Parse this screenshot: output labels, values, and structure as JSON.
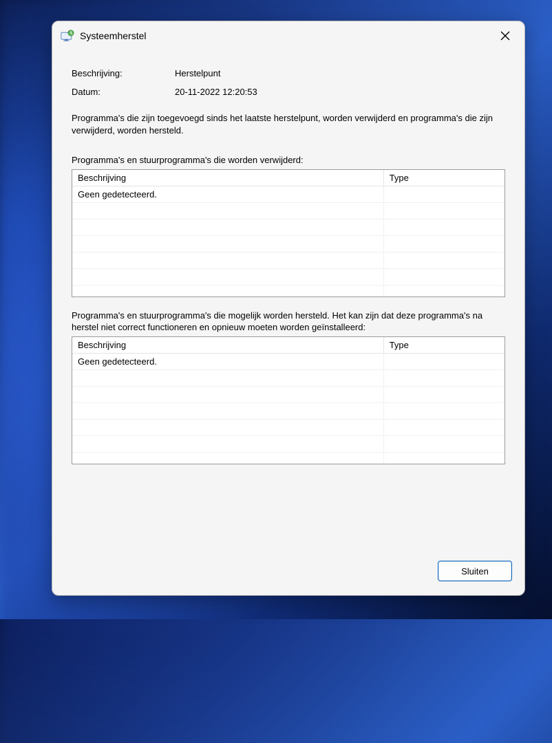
{
  "titlebar": {
    "title": "Systeemherstel"
  },
  "info": {
    "desc_label": "Beschrijving:",
    "desc_value": "Herstelpunt",
    "date_label": "Datum:",
    "date_value": "20-11-2022 12:20:53"
  },
  "explain": "Programma's die zijn toegevoegd sinds het laatste herstelpunt, worden verwijderd en programma's die zijn verwijderd, worden hersteld.",
  "removed": {
    "label": "Programma's en stuurprogramma's die worden verwijderd:",
    "columns": {
      "desc": "Beschrijving",
      "type": "Type"
    },
    "none": "Geen gedetecteerd."
  },
  "restored": {
    "label": "Programma's en stuurprogramma's die mogelijk worden hersteld. Het kan zijn dat deze programma's na herstel niet correct functioneren en opnieuw moeten worden geïnstalleerd:",
    "columns": {
      "desc": "Beschrijving",
      "type": "Type"
    },
    "none": "Geen gedetecteerd."
  },
  "footer": {
    "close_label": "Sluiten"
  }
}
